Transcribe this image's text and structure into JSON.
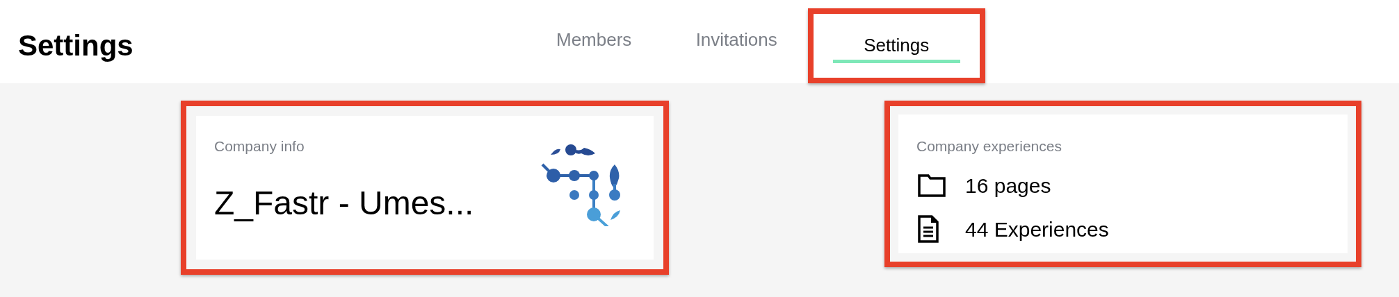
{
  "header": {
    "title": "Settings"
  },
  "tabs": [
    {
      "label": "Members",
      "selected": false,
      "highlighted": false
    },
    {
      "label": "Invitations",
      "selected": false,
      "highlighted": false
    },
    {
      "label": "Settings",
      "selected": true,
      "highlighted": true
    }
  ],
  "company_info": {
    "highlighted": true,
    "label": "Company info",
    "name": "Z_Fastr - Umes..."
  },
  "company_experiences": {
    "highlighted": true,
    "label": "Company experiences",
    "stats": [
      {
        "kind": "folder",
        "text": "16 pages"
      },
      {
        "kind": "document",
        "text": "44 Experiences"
      }
    ]
  }
}
